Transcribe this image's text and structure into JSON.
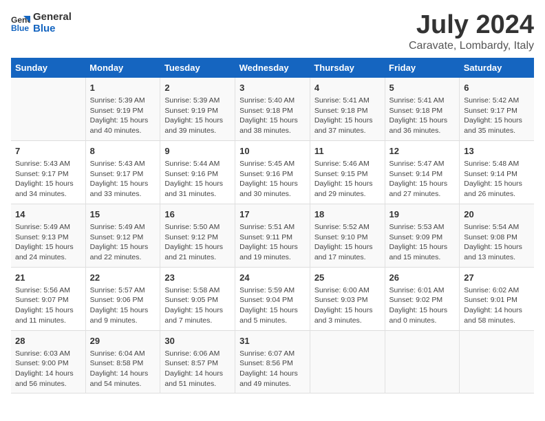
{
  "logo": {
    "line1": "General",
    "line2": "Blue"
  },
  "title": "July 2024",
  "subtitle": "Caravate, Lombardy, Italy",
  "days_of_week": [
    "Sunday",
    "Monday",
    "Tuesday",
    "Wednesday",
    "Thursday",
    "Friday",
    "Saturday"
  ],
  "weeks": [
    [
      {
        "day": "",
        "info": ""
      },
      {
        "day": "1",
        "info": "Sunrise: 5:39 AM\nSunset: 9:19 PM\nDaylight: 15 hours\nand 40 minutes."
      },
      {
        "day": "2",
        "info": "Sunrise: 5:39 AM\nSunset: 9:19 PM\nDaylight: 15 hours\nand 39 minutes."
      },
      {
        "day": "3",
        "info": "Sunrise: 5:40 AM\nSunset: 9:18 PM\nDaylight: 15 hours\nand 38 minutes."
      },
      {
        "day": "4",
        "info": "Sunrise: 5:41 AM\nSunset: 9:18 PM\nDaylight: 15 hours\nand 37 minutes."
      },
      {
        "day": "5",
        "info": "Sunrise: 5:41 AM\nSunset: 9:18 PM\nDaylight: 15 hours\nand 36 minutes."
      },
      {
        "day": "6",
        "info": "Sunrise: 5:42 AM\nSunset: 9:17 PM\nDaylight: 15 hours\nand 35 minutes."
      }
    ],
    [
      {
        "day": "7",
        "info": "Sunrise: 5:43 AM\nSunset: 9:17 PM\nDaylight: 15 hours\nand 34 minutes."
      },
      {
        "day": "8",
        "info": "Sunrise: 5:43 AM\nSunset: 9:17 PM\nDaylight: 15 hours\nand 33 minutes."
      },
      {
        "day": "9",
        "info": "Sunrise: 5:44 AM\nSunset: 9:16 PM\nDaylight: 15 hours\nand 31 minutes."
      },
      {
        "day": "10",
        "info": "Sunrise: 5:45 AM\nSunset: 9:16 PM\nDaylight: 15 hours\nand 30 minutes."
      },
      {
        "day": "11",
        "info": "Sunrise: 5:46 AM\nSunset: 9:15 PM\nDaylight: 15 hours\nand 29 minutes."
      },
      {
        "day": "12",
        "info": "Sunrise: 5:47 AM\nSunset: 9:14 PM\nDaylight: 15 hours\nand 27 minutes."
      },
      {
        "day": "13",
        "info": "Sunrise: 5:48 AM\nSunset: 9:14 PM\nDaylight: 15 hours\nand 26 minutes."
      }
    ],
    [
      {
        "day": "14",
        "info": "Sunrise: 5:49 AM\nSunset: 9:13 PM\nDaylight: 15 hours\nand 24 minutes."
      },
      {
        "day": "15",
        "info": "Sunrise: 5:49 AM\nSunset: 9:12 PM\nDaylight: 15 hours\nand 22 minutes."
      },
      {
        "day": "16",
        "info": "Sunrise: 5:50 AM\nSunset: 9:12 PM\nDaylight: 15 hours\nand 21 minutes."
      },
      {
        "day": "17",
        "info": "Sunrise: 5:51 AM\nSunset: 9:11 PM\nDaylight: 15 hours\nand 19 minutes."
      },
      {
        "day": "18",
        "info": "Sunrise: 5:52 AM\nSunset: 9:10 PM\nDaylight: 15 hours\nand 17 minutes."
      },
      {
        "day": "19",
        "info": "Sunrise: 5:53 AM\nSunset: 9:09 PM\nDaylight: 15 hours\nand 15 minutes."
      },
      {
        "day": "20",
        "info": "Sunrise: 5:54 AM\nSunset: 9:08 PM\nDaylight: 15 hours\nand 13 minutes."
      }
    ],
    [
      {
        "day": "21",
        "info": "Sunrise: 5:56 AM\nSunset: 9:07 PM\nDaylight: 15 hours\nand 11 minutes."
      },
      {
        "day": "22",
        "info": "Sunrise: 5:57 AM\nSunset: 9:06 PM\nDaylight: 15 hours\nand 9 minutes."
      },
      {
        "day": "23",
        "info": "Sunrise: 5:58 AM\nSunset: 9:05 PM\nDaylight: 15 hours\nand 7 minutes."
      },
      {
        "day": "24",
        "info": "Sunrise: 5:59 AM\nSunset: 9:04 PM\nDaylight: 15 hours\nand 5 minutes."
      },
      {
        "day": "25",
        "info": "Sunrise: 6:00 AM\nSunset: 9:03 PM\nDaylight: 15 hours\nand 3 minutes."
      },
      {
        "day": "26",
        "info": "Sunrise: 6:01 AM\nSunset: 9:02 PM\nDaylight: 15 hours\nand 0 minutes."
      },
      {
        "day": "27",
        "info": "Sunrise: 6:02 AM\nSunset: 9:01 PM\nDaylight: 14 hours\nand 58 minutes."
      }
    ],
    [
      {
        "day": "28",
        "info": "Sunrise: 6:03 AM\nSunset: 9:00 PM\nDaylight: 14 hours\nand 56 minutes."
      },
      {
        "day": "29",
        "info": "Sunrise: 6:04 AM\nSunset: 8:58 PM\nDaylight: 14 hours\nand 54 minutes."
      },
      {
        "day": "30",
        "info": "Sunrise: 6:06 AM\nSunset: 8:57 PM\nDaylight: 14 hours\nand 51 minutes."
      },
      {
        "day": "31",
        "info": "Sunrise: 6:07 AM\nSunset: 8:56 PM\nDaylight: 14 hours\nand 49 minutes."
      },
      {
        "day": "",
        "info": ""
      },
      {
        "day": "",
        "info": ""
      },
      {
        "day": "",
        "info": ""
      }
    ]
  ]
}
